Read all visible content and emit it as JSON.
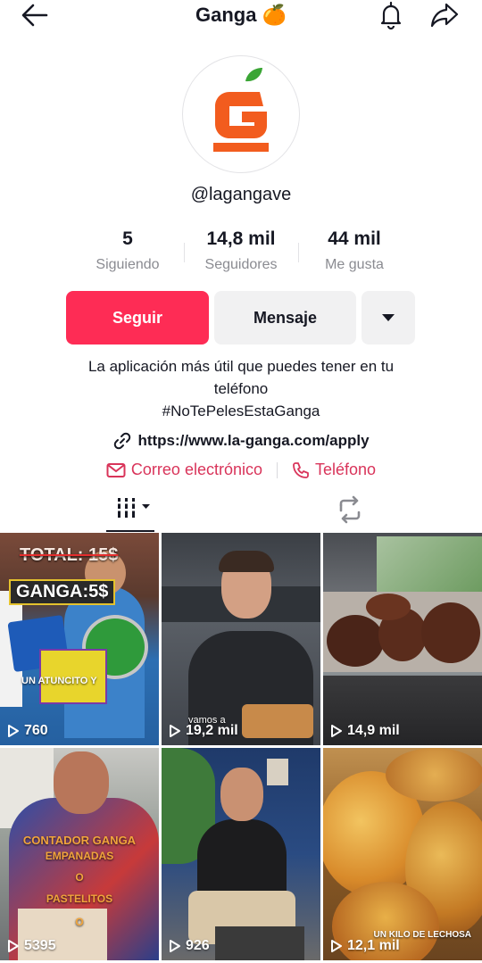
{
  "header": {
    "title": "Ganga 🍊"
  },
  "profile": {
    "username": "@lagangave",
    "stats": [
      {
        "value": "5",
        "label": "Siguiendo"
      },
      {
        "value": "14,8 mil",
        "label": "Seguidores"
      },
      {
        "value": "44 mil",
        "label": "Me gusta"
      }
    ],
    "actions": {
      "follow": "Seguir",
      "message": "Mensaje"
    },
    "bio": {
      "line1": "La aplicación más útil que puedes tener en tu",
      "line2": "teléfono",
      "line3": "#NoTePelesEstaGanga"
    },
    "link": "https://www.la-ganga.com/apply",
    "contacts": {
      "email": "Correo electrónico",
      "phone": "Teléfono"
    }
  },
  "brand_colors": {
    "accent": "#fe2c55",
    "contact": "#d9345a",
    "logo_orange": "#f25c1e",
    "logo_leaf": "#3aa535"
  },
  "videos": [
    {
      "views": "760",
      "caption_top": "TOTAL: 15$",
      "caption_mid": "GANGA:5$",
      "caption_bottom": "UN ATUNCITO Y"
    },
    {
      "views": "19,2 mil",
      "caption": "vamos a"
    },
    {
      "views": "14,9 mil"
    },
    {
      "views": "5395",
      "caption_a": "CONTADOR GANGA",
      "caption_b": "EMPANADAS",
      "caption_c": "O",
      "caption_d": "PASTELITOS",
      "caption_e": "O"
    },
    {
      "views": "926"
    },
    {
      "views": "12,1 mil",
      "caption": "UN KILO DE LECHOSA"
    }
  ]
}
